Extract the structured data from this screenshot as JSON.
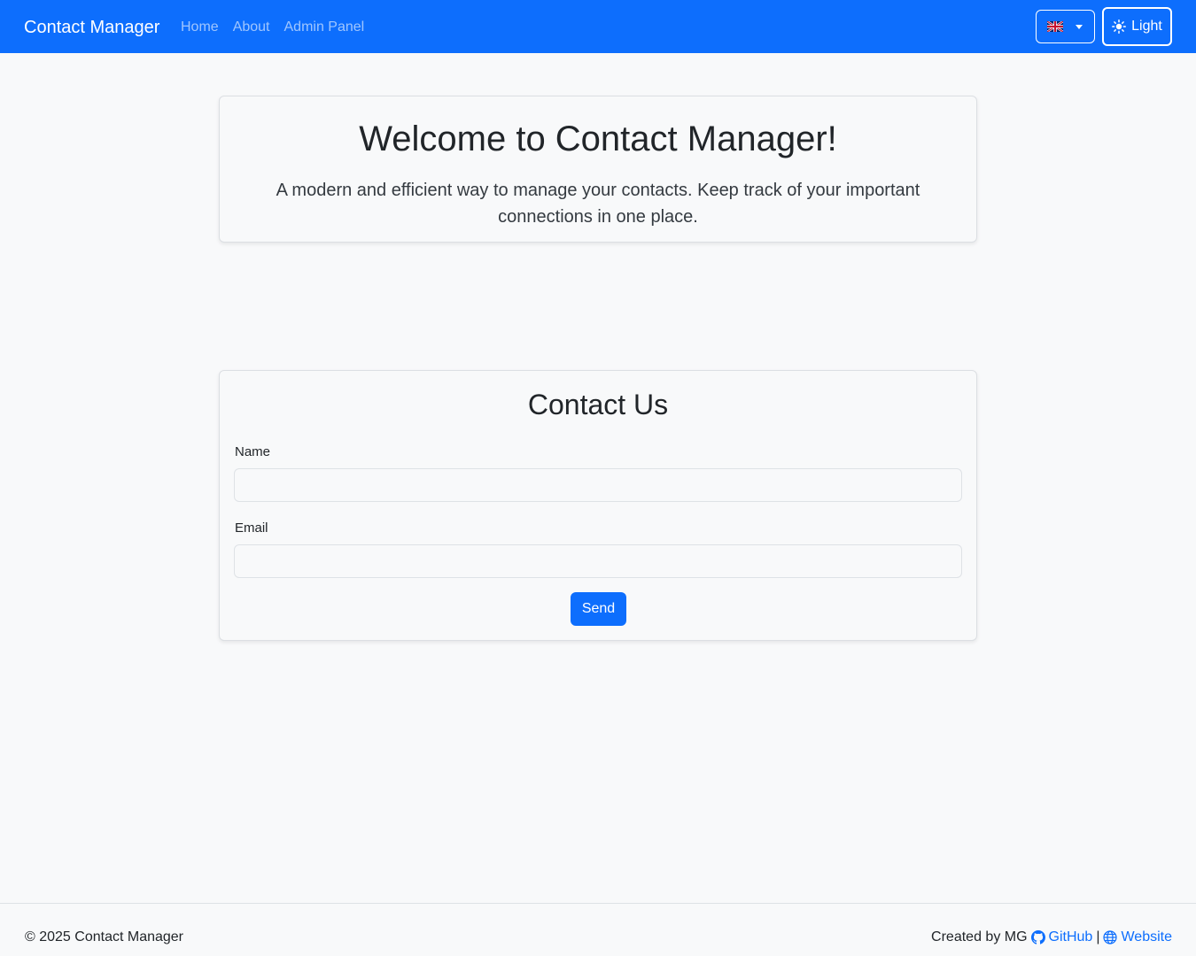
{
  "navbar": {
    "brand": "Contact Manager",
    "links": [
      "Home",
      "About",
      "Admin Panel"
    ],
    "language_icon": "uk-flag-icon",
    "theme_label": "Light",
    "theme_icon": "sun-icon",
    "accent_color": "#0d6efd"
  },
  "welcome": {
    "title": "Welcome to Contact Manager!",
    "text": "A modern and efficient way to manage your contacts. Keep track of your important connections in one place."
  },
  "contact_form": {
    "title": "Contact Us",
    "name_label": "Name",
    "name_value": "",
    "email_label": "Email",
    "email_value": "",
    "send_label": "Send"
  },
  "footer": {
    "copyright": "© 2025 Contact Manager",
    "created_by": "Created by MG",
    "github_label": "GitHub",
    "separator": "|",
    "website_label": "Website"
  }
}
